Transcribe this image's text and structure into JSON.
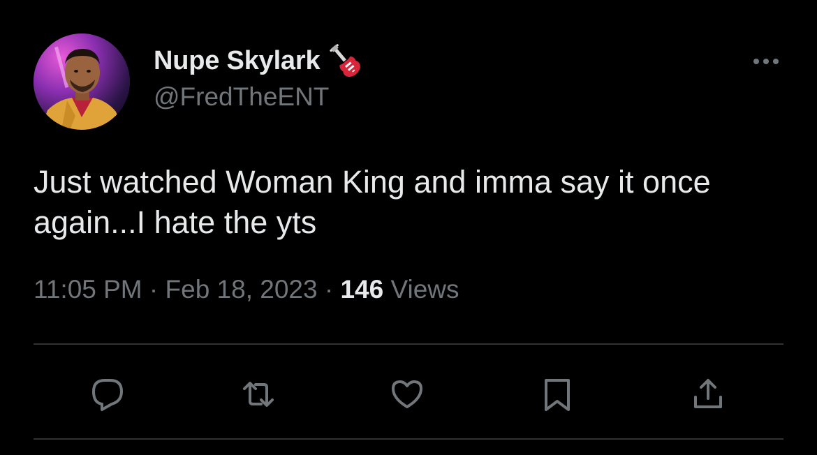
{
  "author": {
    "display_name": "Nupe Skylark",
    "badge_emoji": "guitar-icon",
    "handle": "@FredTheENT"
  },
  "tweet": {
    "text": "Just watched Woman King and imma say it once again...I hate the yts"
  },
  "meta": {
    "time": "11:05 PM",
    "separator": "·",
    "date": "Feb 18, 2023",
    "views_count": "146",
    "views_label": "Views"
  },
  "actions": [
    {
      "icon": "reply-icon"
    },
    {
      "icon": "retweet-icon"
    },
    {
      "icon": "like-icon"
    },
    {
      "icon": "bookmark-icon"
    },
    {
      "icon": "share-icon"
    }
  ],
  "colors": {
    "background": "#000000",
    "primary_text": "#e7e9ea",
    "secondary_text": "#71767b",
    "divider": "#2f3336"
  }
}
